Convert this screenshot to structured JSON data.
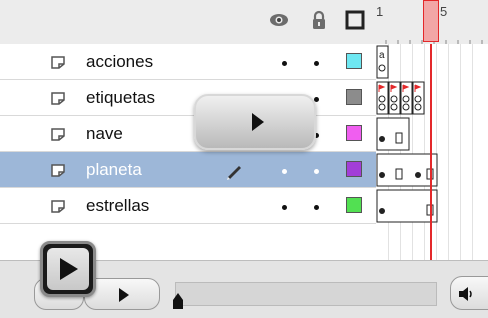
{
  "header": {
    "icons": [
      "eye-icon",
      "lock-icon",
      "outline-icon"
    ],
    "frame_labels": [
      "1",
      "5"
    ]
  },
  "layers": [
    {
      "name": "acciones",
      "color": "#6ee8f2",
      "selected": false
    },
    {
      "name": "etiquetas",
      "color": "#8c8c8c",
      "selected": false
    },
    {
      "name": "nave",
      "color": "#f05ef0",
      "selected": false
    },
    {
      "name": "planeta",
      "color": "#a23ed8",
      "selected": true
    },
    {
      "name": "estrellas",
      "color": "#52e052",
      "selected": false
    }
  ],
  "colors": {
    "playhead": "#e3282a",
    "selection": "#9db7d8",
    "label_flag": "#e3282a"
  },
  "overlay_play": {
    "icon": "play-icon"
  },
  "footer": {
    "icons": [
      "play-icon",
      "play-icon",
      "speaker-icon"
    ]
  }
}
